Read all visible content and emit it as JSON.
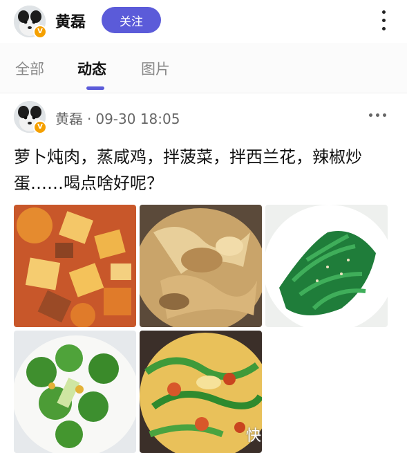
{
  "header": {
    "user_name": "黄磊",
    "follow_label": "关注",
    "more_icon": "more-vertical-icon"
  },
  "tabs": [
    {
      "label": "全部",
      "active": false
    },
    {
      "label": "动态",
      "active": true
    },
    {
      "label": "图片",
      "active": false
    }
  ],
  "post": {
    "author": "黄磊",
    "separator": "·",
    "timestamp": "09-30 18:05",
    "text": "萝卜炖肉，蒸咸鸡，拌菠菜，拌西兰花，辣椒炒蛋……喝点啥好呢？",
    "more_icon": "more-horizontal-icon"
  },
  "photos": {
    "watermark": "快"
  },
  "colors": {
    "accent": "#5b5bd9",
    "verified_badge": "#f5a000"
  }
}
